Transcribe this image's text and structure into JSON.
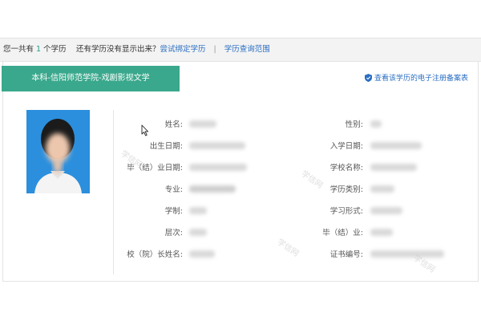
{
  "summary": {
    "prefix": "您一共有",
    "count": "1",
    "suffix": "个学历",
    "question": "还有学历没有显示出来？",
    "link_bind": "尝试绑定学历",
    "separator": "|",
    "link_scope": "学历查询范围"
  },
  "record": {
    "tab_label": "本科-信阳师范学院-戏剧影视文学",
    "register_link": "查看该学历的电子注册备案表",
    "left_fields": [
      {
        "label": "姓名:"
      },
      {
        "label": "出生日期:"
      },
      {
        "label": "毕（结）业日期:"
      },
      {
        "label": "专业:"
      },
      {
        "label": "学制:"
      },
      {
        "label": "层次:"
      },
      {
        "label": "校（院）长姓名:"
      }
    ],
    "right_fields": [
      {
        "label": "性别:"
      },
      {
        "label": "入学日期:"
      },
      {
        "label": "学校名称:"
      },
      {
        "label": "学历类别:"
      },
      {
        "label": "学习形式:"
      },
      {
        "label": "毕（结）业:"
      },
      {
        "label": "证书编号:"
      }
    ]
  },
  "watermark": "学信网",
  "colors": {
    "accent": "#3aa88c",
    "link": "#2a6ec2",
    "count": "#1e9e88",
    "photo_bg": "#2b8fdd"
  }
}
